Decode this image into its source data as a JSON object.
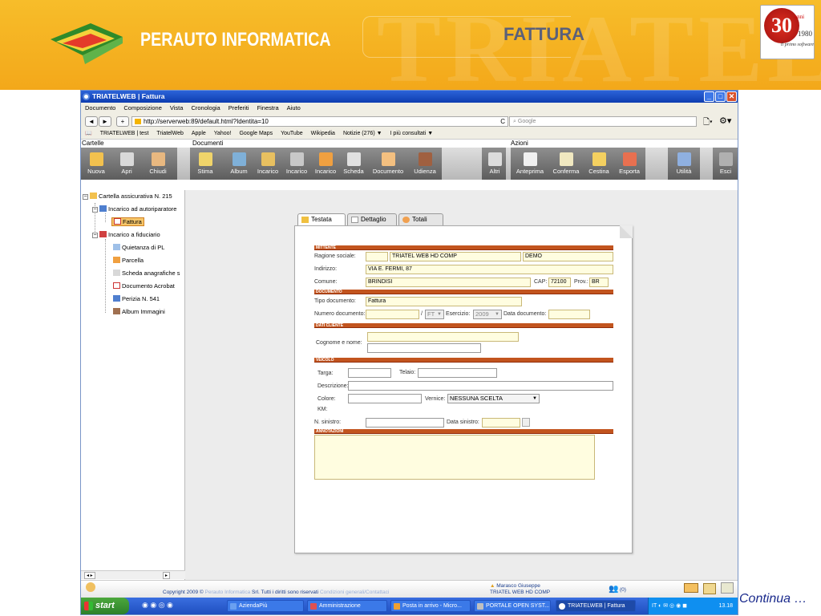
{
  "slide": {
    "brand": "PERAUTO INFORMATICA",
    "title": "FATTURA",
    "badge_number": "30",
    "badge_anni": "anni",
    "badge_year": "1980",
    "badge_tagline": "il primo software",
    "continua": "Continua …"
  },
  "window": {
    "title": "TRIATELWEB | Fattura",
    "minimize": "_",
    "maximize": "□",
    "close": "✕"
  },
  "menu": [
    "Documento",
    "Composizione",
    "Vista",
    "Cronologia",
    "Preferiti",
    "Finestra",
    "Aiuto"
  ],
  "nav": {
    "back": "◄",
    "forward": "►",
    "add": "+",
    "url": "http://serverweb:89/default.html?Identita=10",
    "search_placeholder": "Google",
    "reload": "C"
  },
  "bookmarks": [
    "TRIATELWEB | test",
    "TriatelWeb",
    "Apple",
    "Yahoo!",
    "Google Maps",
    "YouTube",
    "Wikipedia",
    "Notizie (276) ▼",
    "I più consultati ▼"
  ],
  "sections": {
    "cartelle": "Cartelle",
    "documenti": "Documenti",
    "azioni": "Azioni"
  },
  "toolbar": {
    "cartelle": [
      "Nuova",
      "Apri",
      "Chiudi"
    ],
    "documenti": [
      "Stima",
      "Album",
      "Incarico",
      "Incarico",
      "Incarico",
      "Scheda",
      "Documento",
      "Udienza"
    ],
    "altri": "Altri",
    "azioni": [
      "Anteprima",
      "Conferma",
      "Cestina",
      "Esporta"
    ],
    "utilita": "Utilità",
    "esci": "Esci"
  },
  "tree": {
    "root": "Cartella assicurativa N. 215",
    "incarico_autoriparatore": "Incarico ad autoriparatore",
    "fattura": "Fattura",
    "incarico_fiduciario": "Incarico a fiduciario",
    "children": [
      "Quietanza di PL",
      "Parcella",
      "Scheda anagrafiche s",
      "Documento Acrobat",
      "Perizia N. 541",
      "Album Immagini"
    ]
  },
  "tabs": [
    "Testata",
    "Dettaglio",
    "Totali"
  ],
  "form": {
    "mittente": "MITTENTE",
    "ragione_label": "Ragione sociale:",
    "ragione_value": "TRIATEL WEB HD COMP",
    "ragione_value2": "DEMO",
    "indirizzo_label": "Indirizzo:",
    "indirizzo_value": "VIA E. FERMI, 87",
    "comune_label": "Comune:",
    "comune_value": "BRINDISI",
    "cap_label": "CAP:",
    "cap_value": "72100",
    "prov_label": "Prov.:",
    "prov_value": "BR",
    "documento": "DOCUMENTO",
    "tipo_label": "Tipo documento:",
    "tipo_value": "Fattura",
    "numero_label": "Numero documento:",
    "numero_sep": "/",
    "serie_value": "FT",
    "esercizio_label": "Esercizio:",
    "esercizio_value": "2009",
    "data_doc_label": "Data documento:",
    "dati_cliente": "DATI CLIENTE",
    "cognome_label": "Cognome e nome:",
    "veicolo": "VEICOLO",
    "targa_label": "Targa:",
    "telaio_label": "Telaio:",
    "descrizione_label": "Descrizione:",
    "colore_label": "Colore:",
    "vernice_label": "Vernice:",
    "vernice_value": "NESSUNA SCELTA",
    "km_label": "KM:",
    "sinistro_label": "N. sinistro:",
    "data_sinistro_label": "Data sinistro:",
    "annotazioni": "ANNOTAZIONI"
  },
  "status": {
    "copyright": "Copyright 2009 ©",
    "company_link": "Perauto Informatica",
    "rights": "Srl. Tutti i diritti sono riservati",
    "conditions_link": "Condizioni generali/Contattaci",
    "user_name": "Marasco Giuseppe",
    "user_company": "TRIATEL WEB HD COMP",
    "messages": "(0)"
  },
  "taskbar": {
    "start": "start",
    "tasks": [
      "AziendaPiù",
      "Amministrazione",
      "Posta in arrivo - Micro...",
      "PORTALE OPEN SYST...",
      "TRIATELWEB | Fattura"
    ],
    "lang": "IT",
    "clock": "13.18"
  },
  "colors": {
    "header_orange": "#f3a81a",
    "section_bar": "#c2541e",
    "title_blue": "#0e3db0",
    "field_yellow": "#fffde0"
  }
}
